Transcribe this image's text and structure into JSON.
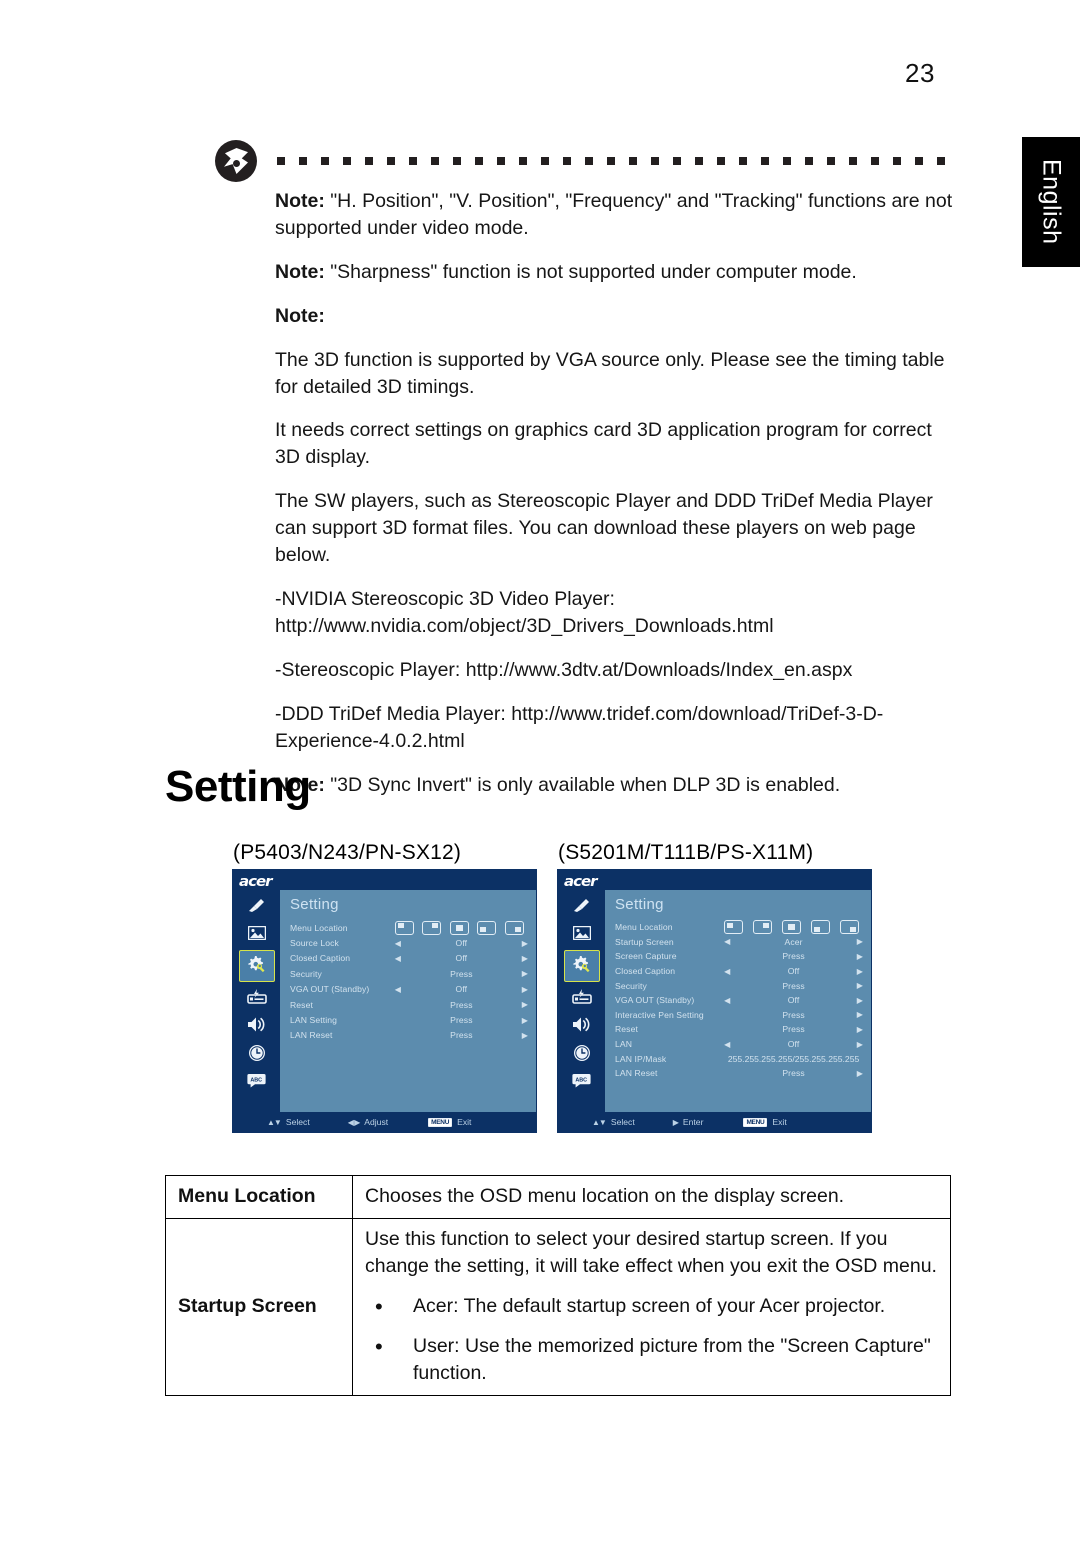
{
  "page": {
    "number": "23",
    "language_tab": "English"
  },
  "notes": {
    "items": [
      {
        "bold": "Note:",
        "text": " \"H. Position\", \"V. Position\", \"Frequency\" and \"Tracking\" functions are not supported under video mode."
      },
      {
        "bold": "Note:",
        "text": " \"Sharpness\" function is not supported under computer mode."
      },
      {
        "bold": "Note:",
        "text": ""
      },
      {
        "bold": "",
        "text": "The 3D function is supported by VGA source only. Please see the timing table for detailed 3D timings."
      },
      {
        "bold": "",
        "text": "It needs correct settings on graphics card 3D application program for correct 3D display."
      },
      {
        "bold": "",
        "text": "The SW players, such as Stereoscopic Player and DDD TriDef Media Player can support 3D format files. You can download these players on web page below."
      },
      {
        "bold": "",
        "text": "-NVIDIA Stereoscopic 3D Video Player: http://www.nvidia.com/object/3D_Drivers_Downloads.html"
      },
      {
        "bold": "",
        "text": "-Stereoscopic Player: http://www.3dtv.at/Downloads/Index_en.aspx"
      },
      {
        "bold": "",
        "text": "-DDD TriDef Media Player: http://www.tridef.com/download/TriDef-3-D-Experience-4.0.2.html"
      },
      {
        "bold": "Note:",
        "text": " \"3D Sync Invert\" is only available when DLP 3D is enabled."
      }
    ]
  },
  "section": {
    "heading": "Setting"
  },
  "osd_left": {
    "model_caption": "(P5403/N243/PN-SX12)",
    "brand": "acer",
    "title": "Setting",
    "rail_icons": [
      "color-wand-icon",
      "image-icon",
      "gear-wrench-icon",
      "power-management-icon",
      "speaker-icon",
      "clock-icon",
      "language-icon"
    ],
    "selected_rail_index": 2,
    "menu_location_label": "Menu Location",
    "menu_location_options": [
      "top-left",
      "top-right",
      "center",
      "bottom-left",
      "bottom-right"
    ],
    "menu_location_selected": "center",
    "rows": [
      {
        "label": "Source Lock",
        "value": "Off",
        "left_arrow": true,
        "right_arrow": true
      },
      {
        "label": "Closed Caption",
        "value": "Off",
        "left_arrow": true,
        "right_arrow": true
      },
      {
        "label": "Security",
        "value": "Press",
        "left_arrow": false,
        "right_arrow": true
      },
      {
        "label": "VGA OUT (Standby)",
        "value": "Off",
        "left_arrow": true,
        "right_arrow": true
      },
      {
        "label": "Reset",
        "value": "Press",
        "left_arrow": false,
        "right_arrow": true
      },
      {
        "label": "LAN Setting",
        "value": "Press",
        "left_arrow": false,
        "right_arrow": true
      },
      {
        "label": "LAN Reset",
        "value": "Press",
        "left_arrow": false,
        "right_arrow": true
      }
    ],
    "footer": {
      "select_keys": "▲▼",
      "select_label": "Select",
      "adjust_keys": "◀ ▶",
      "adjust_label": "Adjust",
      "menu_key": "MENU",
      "exit_label": "Exit"
    }
  },
  "osd_right": {
    "model_caption": "(S5201M/T111B/PS-X11M)",
    "brand": "acer",
    "title": "Setting",
    "rail_icons": [
      "color-wand-icon",
      "image-icon",
      "gear-wrench-icon",
      "power-management-icon",
      "speaker-icon",
      "clock-icon",
      "language-icon"
    ],
    "selected_rail_index": 2,
    "menu_location_label": "Menu Location",
    "menu_location_options": [
      "top-left",
      "top-right",
      "center",
      "bottom-left",
      "bottom-right"
    ],
    "menu_location_selected": "center",
    "rows": [
      {
        "label": "Startup Screen",
        "value": "Acer",
        "left_arrow": true,
        "right_arrow": true
      },
      {
        "label": "Screen Capture",
        "value": "Press",
        "left_arrow": false,
        "right_arrow": true
      },
      {
        "label": "Closed Caption",
        "value": "Off",
        "left_arrow": true,
        "right_arrow": true
      },
      {
        "label": "Security",
        "value": "Press",
        "left_arrow": false,
        "right_arrow": true
      },
      {
        "label": "VGA OUT (Standby)",
        "value": "Off",
        "left_arrow": true,
        "right_arrow": true
      },
      {
        "label": "Interactive Pen Setting",
        "value": "Press",
        "left_arrow": false,
        "right_arrow": true
      },
      {
        "label": "Reset",
        "value": "Press",
        "left_arrow": false,
        "right_arrow": true
      },
      {
        "label": "LAN",
        "value": "Off",
        "left_arrow": true,
        "right_arrow": true
      },
      {
        "label": "LAN IP/Mask",
        "value": "255.255.255.255/255.255.255.255",
        "left_arrow": false,
        "right_arrow": false
      },
      {
        "label": "LAN Reset",
        "value": "Press",
        "left_arrow": false,
        "right_arrow": true
      }
    ],
    "footer": {
      "select_keys": "▲▼",
      "select_label": "Select",
      "adjust_keys": "▶",
      "adjust_label": "Enter",
      "menu_key": "MENU",
      "exit_label": "Exit"
    }
  },
  "spec_table": {
    "rows": [
      {
        "key": "Menu Location",
        "desc": "Chooses the OSD menu location on the display screen.",
        "bullets": []
      },
      {
        "key": "Startup Screen",
        "desc": "Use this function to select your desired startup screen. If you change the setting, it will take effect when you exit the OSD menu.",
        "bullets": [
          "Acer: The default startup screen of your Acer projector.",
          "User: Use the memorized picture from the \"Screen Capture\" function."
        ]
      }
    ]
  },
  "colors": {
    "osd_dark": "#0c3165",
    "osd_panel": "#5c8cae",
    "osd_select_border": "#d6e34a",
    "osd_text": "#d2e2ee"
  }
}
